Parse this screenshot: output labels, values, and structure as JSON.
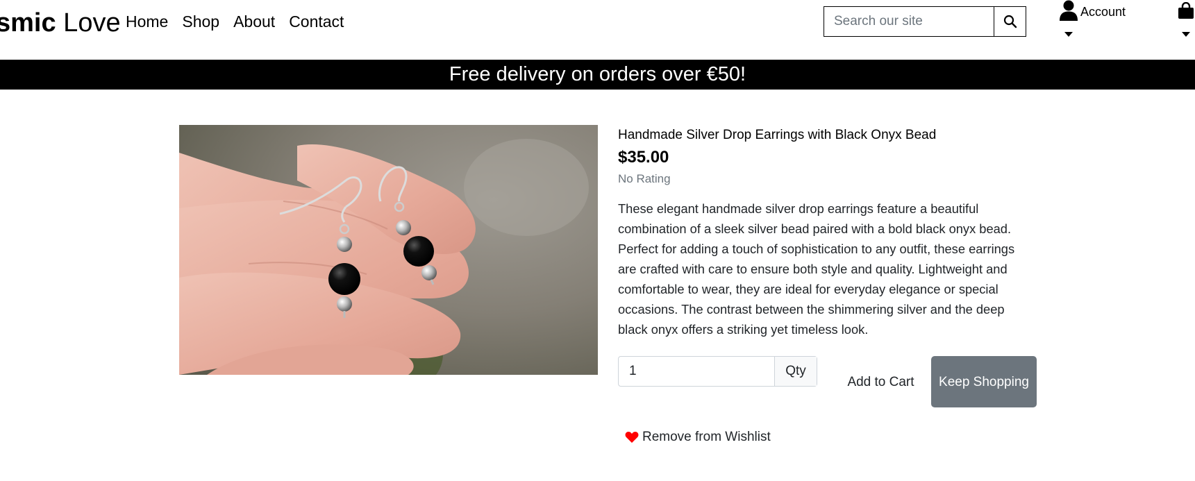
{
  "header": {
    "brand_bold": "smic",
    "brand_rest": " Love",
    "nav": [
      "Home",
      "Shop",
      "About",
      "Contact"
    ],
    "search_placeholder": "Search our site",
    "account_label": "Account"
  },
  "banner": {
    "text": "Free delivery on orders over €50!"
  },
  "product": {
    "title": "Handmade Silver Drop Earrings with Black Onyx Bead",
    "price": "$35.00",
    "rating": "No Rating",
    "description": "These elegant handmade silver drop earrings feature a beautiful combination of a sleek silver bead paired with a bold black onyx bead. Perfect for adding a touch of sophistication to any outfit, these earrings are crafted with care to ensure both style and quality. Lightweight and comfortable to wear, they are ideal for everyday elegance or special occasions. The contrast between the shimmering silver and the deep black onyx offers a striking yet timeless look.",
    "quantity": "1",
    "qty_label": "Qty",
    "add_to_cart": "Add to Cart",
    "keep_shopping": "Keep Shopping",
    "wishlist": "Remove from Wishlist"
  },
  "colors": {
    "banner_bg": "#000000",
    "secondary_button": "#6c757d",
    "heart": "#ff0000"
  }
}
